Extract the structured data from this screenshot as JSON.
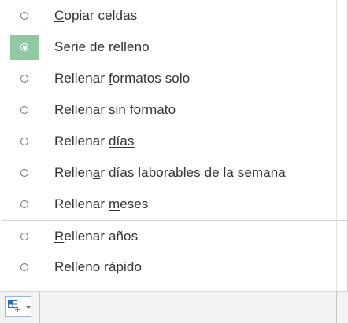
{
  "autofill_menu": {
    "items": [
      {
        "pre": "",
        "ul": "C",
        "post": "opiar celdas",
        "selected": false
      },
      {
        "pre": "",
        "ul": "S",
        "post": "erie de relleno",
        "selected": true
      },
      {
        "pre": "Rellenar ",
        "ul": "f",
        "post": "ormatos solo",
        "selected": false
      },
      {
        "pre": "Rellenar sin f",
        "ul": "o",
        "post": "rmato",
        "selected": false
      },
      {
        "pre": "Rellenar ",
        "ul": "días",
        "post": "",
        "selected": false
      },
      {
        "pre": "Rellen",
        "ul": "a",
        "post": "r días laborables de la semana",
        "selected": false
      },
      {
        "pre": "Rellenar ",
        "ul": "m",
        "post": "eses",
        "selected": false
      },
      {
        "pre": "",
        "ul": "R",
        "post": "ellenar años",
        "selected": false
      },
      {
        "pre": "",
        "ul": "R",
        "post": "elleno rápido",
        "selected": false
      }
    ]
  },
  "autofill_options_button": {
    "icon": "autofill-options-icon",
    "dropdown_icon": "chevron-down-icon"
  },
  "colors": {
    "selected_highlight": "#8fc8a3",
    "text": "#333333",
    "icon_blue": "#2e6db4",
    "icon_green": "#3a8f4f"
  }
}
